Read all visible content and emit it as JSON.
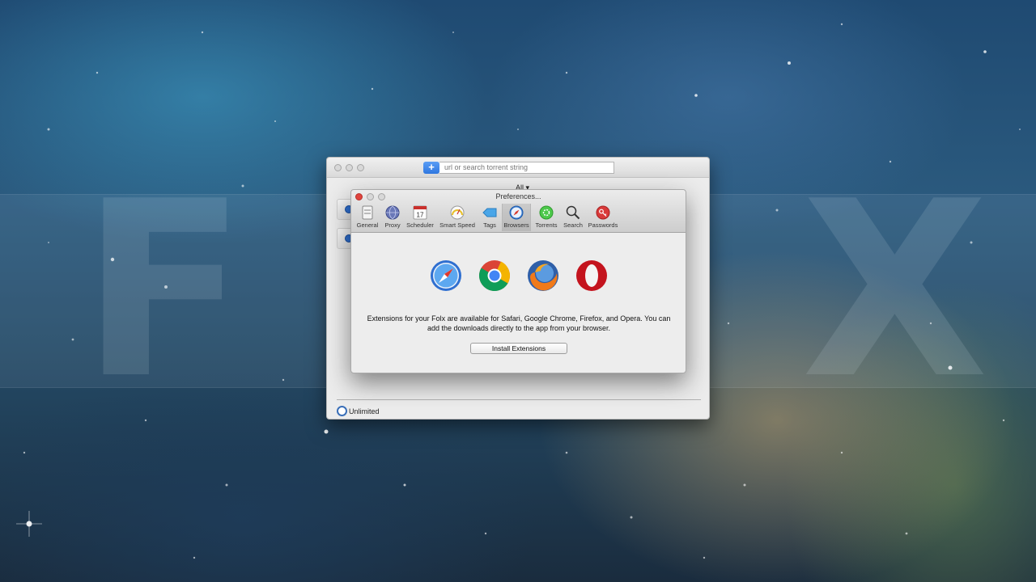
{
  "background": {
    "logo_letters": [
      "F",
      "X"
    ]
  },
  "main_window": {
    "add_label": "+",
    "url_placeholder": "url or search torrent string",
    "filter_label": "All ▾",
    "speed_limit_label": "Unlimited"
  },
  "preferences": {
    "title": "Preferences...",
    "toolbar": [
      {
        "label": "General",
        "icon": "general-icon"
      },
      {
        "label": "Proxy",
        "icon": "proxy-icon"
      },
      {
        "label": "Scheduler",
        "icon": "scheduler-icon",
        "badge": "17"
      },
      {
        "label": "Smart Speed",
        "icon": "speedometer-icon"
      },
      {
        "label": "Tags",
        "icon": "tag-icon"
      },
      {
        "label": "Browsers",
        "icon": "compass-icon",
        "selected": true
      },
      {
        "label": "Torrents",
        "icon": "torrent-icon"
      },
      {
        "label": "Search",
        "icon": "magnifier-icon"
      },
      {
        "label": "Passwords",
        "icon": "key-icon"
      }
    ],
    "browsers": [
      "safari",
      "chrome",
      "firefox",
      "opera"
    ],
    "description": "Extensions for your Folx are available for Safari, Google Chrome, Firefox, and Opera. You can add the downloads directly to the app from your browser.",
    "install_button": "Install Extensions"
  },
  "colors": {
    "accent": "#2f77e0",
    "close": "#e0443e",
    "opera_red": "#c4141e",
    "torrent_green": "#4cc84a"
  }
}
